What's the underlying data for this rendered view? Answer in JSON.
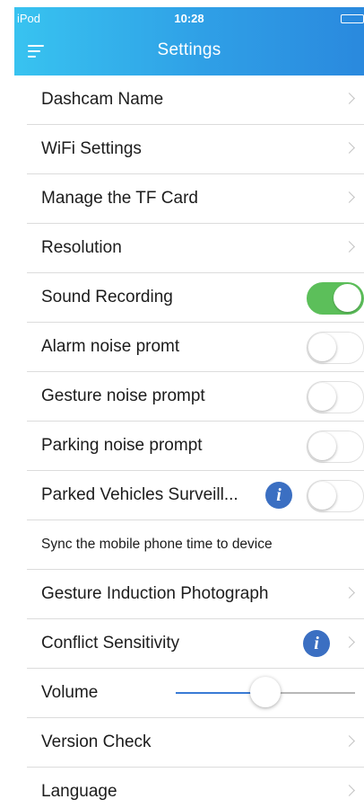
{
  "status_bar": {
    "carrier": "iPod",
    "time": "10:28",
    "battery_fill_color": "#4cd964"
  },
  "nav": {
    "title": "Settings",
    "menu_icon": "hamburger-menu-icon",
    "background_gradient": [
      "#38c3f0",
      "#2a89de"
    ]
  },
  "settings": {
    "dashcam_name": "Dashcam Name",
    "wifi_settings": "WiFi Settings",
    "manage_tf_card": "Manage the TF Card",
    "resolution": "Resolution",
    "sound_recording": "Sound Recording",
    "alarm_noise": "Alarm noise promt",
    "gesture_noise": "Gesture noise prompt",
    "parking_noise": "Parking noise prompt",
    "parked_vehicles": "Parked Vehicles Surveill...",
    "sync_time": "Sync the mobile phone time to device",
    "gesture_photo": "Gesture Induction Photograph",
    "conflict_sensitivity": "Conflict Sensitivity",
    "volume": "Volume",
    "version_check": "Version Check",
    "language": "Language"
  },
  "toggles": {
    "sound_recording": true,
    "alarm_noise": false,
    "gesture_noise": false,
    "parking_noise": false,
    "parked_vehicles": false
  },
  "volume_level": 0.5,
  "info_icon_glyph": "i",
  "colors": {
    "toggle_on": "#5cbf5a",
    "info_icon": "#3b6fc2",
    "slider_fill": "#3a7bd5"
  }
}
